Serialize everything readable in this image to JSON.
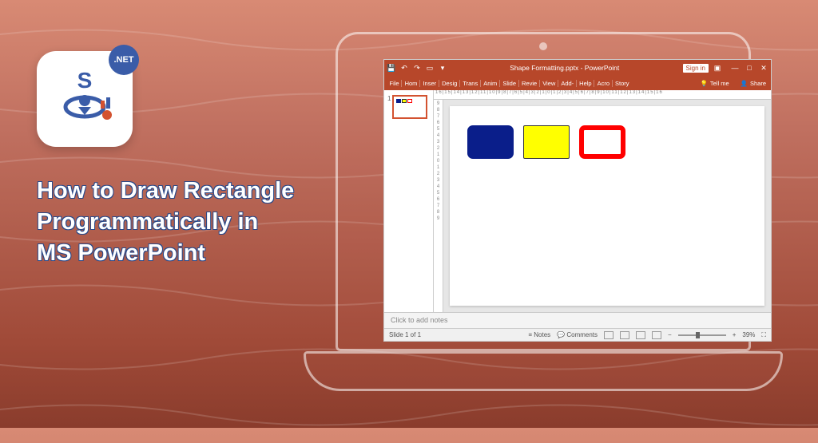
{
  "logo": {
    "letter": "S",
    "badge": ".NET"
  },
  "headline": "How to Draw Rectangle\nProgrammatically in\nMS PowerPoint",
  "app": {
    "titlebar": {
      "doc": "Shape Formatting.pptx - PowerPoint",
      "signin": "Sign in"
    },
    "tabs": [
      "File",
      "Hom",
      "Inser",
      "Desig",
      "Trans",
      "Anim",
      "Slide",
      "Revie",
      "View",
      "Add-",
      "Help",
      "Acro",
      "Story"
    ],
    "tellme": "Tell me",
    "share": "Share",
    "thumb_num": "1",
    "ruler_h": "16|15|14|13|12|11|10|9|8|7|6|5|4|3|2|1|0|1|2|3|4|5|6|7|8|9|10|11|12|13|14|15|16",
    "ruler_v": [
      "9",
      "8",
      "7",
      "6",
      "5",
      "4",
      "3",
      "2",
      "1",
      "0",
      "1",
      "2",
      "3",
      "4",
      "5",
      "6",
      "7",
      "8",
      "9"
    ],
    "notes_placeholder": "Click to add notes",
    "status": {
      "slide": "Slide 1 of 1",
      "notes": "Notes",
      "comments": "Comments",
      "zoom": "39%"
    },
    "shapes": [
      {
        "name": "blue-rectangle",
        "fill": "#0a1e8a"
      },
      {
        "name": "yellow-rectangle",
        "fill": "#ffff00"
      },
      {
        "name": "red-outline-rectangle",
        "stroke": "#ff0000"
      }
    ]
  }
}
